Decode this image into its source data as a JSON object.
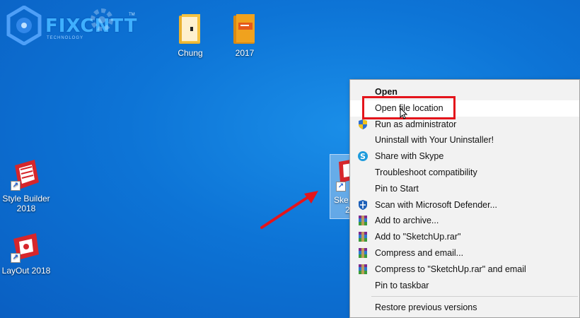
{
  "logo": {
    "text": "FIXCNTT",
    "sub": "TECHNOLOGY",
    "tm": "TM"
  },
  "desktop": {
    "icons": [
      {
        "label": "Chung"
      },
      {
        "label": "2017"
      },
      {
        "label_line1": "Style Builder",
        "label_line2": "2018"
      },
      {
        "label": "LayOut 2018"
      }
    ],
    "selected": {
      "label_line1": "Ske",
      "label_line2": "2"
    }
  },
  "context_menu": {
    "items": [
      {
        "label": "Open",
        "icon": "none"
      },
      {
        "label": "Open file location",
        "icon": "none"
      },
      {
        "label": "Run as administrator",
        "icon": "uac-shield-icon"
      },
      {
        "label": "Uninstall with Your Uninstaller!",
        "icon": "none"
      },
      {
        "label": "Share with Skype",
        "icon": "skype-icon"
      },
      {
        "label": "Troubleshoot compatibility",
        "icon": "none"
      },
      {
        "label": "Pin to Start",
        "icon": "none"
      },
      {
        "label": "Scan with Microsoft Defender...",
        "icon": "defender-icon"
      },
      {
        "label": "Add to archive...",
        "icon": "winrar-icon"
      },
      {
        "label": "Add to \"SketchUp.rar\"",
        "icon": "winrar-icon"
      },
      {
        "label": "Compress and email...",
        "icon": "winrar-icon"
      },
      {
        "label": "Compress to \"SketchUp.rar\" and email",
        "icon": "winrar-icon"
      },
      {
        "label": "Pin to taskbar",
        "icon": "none"
      },
      {
        "label": "Restore previous versions",
        "icon": "none"
      }
    ]
  },
  "colors": {
    "desktop_bg": "#0d74d6",
    "menu_bg": "#f2f2f2",
    "highlight": "#e4141b",
    "folder_yellow": "#f5c342",
    "folder_orange": "#f0a21e",
    "sketchup_red": "#d6262b"
  }
}
